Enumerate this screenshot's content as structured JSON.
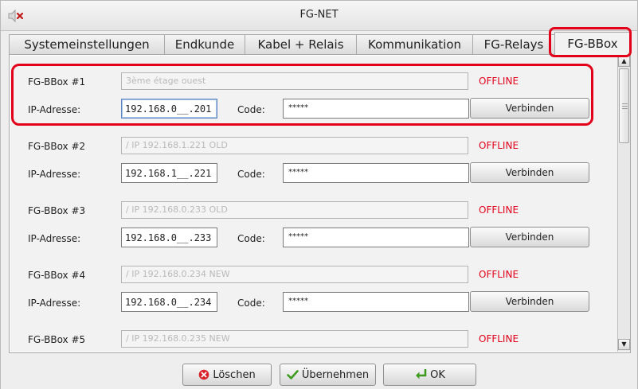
{
  "window": {
    "title": "FG-NET",
    "system_icon": "speaker-muted-icon"
  },
  "tabs": [
    {
      "label": "Systemeinstellungen",
      "active": false
    },
    {
      "label": "Endkunde",
      "active": false
    },
    {
      "label": "Kabel + Relais",
      "active": false
    },
    {
      "label": "Kommunikation",
      "active": false
    },
    {
      "label": "FG-Relays",
      "active": false
    },
    {
      "label": "FG-BBox",
      "active": true
    }
  ],
  "bboxes": [
    {
      "label": "FG-BBox #1",
      "name_value": "3ème étage ouest",
      "status": "OFFLINE",
      "ip_label": "IP-Adresse:",
      "ip_value": "192.168.0__.201",
      "code_label": "Code:",
      "code_value": "*****",
      "connect_label": "Verbinden"
    },
    {
      "label": "FG-BBox #2",
      "name_value": "/ IP 192.168.1.221 OLD",
      "status": "OFFLINE",
      "ip_label": "IP-Adresse:",
      "ip_value": "192.168.1__.221",
      "code_label": "Code:",
      "code_value": "*****",
      "connect_label": "Verbinden"
    },
    {
      "label": "FG-BBox #3",
      "name_value": "/ IP 192.168.0.233 OLD",
      "status": "OFFLINE",
      "ip_label": "IP-Adresse:",
      "ip_value": "192.168.0__.233",
      "code_label": "Code:",
      "code_value": "*****",
      "connect_label": "Verbinden"
    },
    {
      "label": "FG-BBox #4",
      "name_value": "/ IP 192.168.0.234 NEW",
      "status": "OFFLINE",
      "ip_label": "IP-Adresse:",
      "ip_value": "192.168.0__.234",
      "code_label": "Code:",
      "code_value": "*****",
      "connect_label": "Verbinden"
    },
    {
      "label": "FG-BBox #5",
      "name_value": "/ IP 192.168.0.235 NEW",
      "status": "OFFLINE",
      "ip_label": "IP-Adresse:",
      "ip_value": "",
      "code_label": "Code:",
      "code_value": "",
      "connect_label": ""
    }
  ],
  "footer": {
    "delete_label": "Löschen",
    "apply_label": "Übernehmen",
    "ok_label": "OK"
  },
  "colors": {
    "status_offline": "#e2001a",
    "highlight": "#e2001a"
  }
}
